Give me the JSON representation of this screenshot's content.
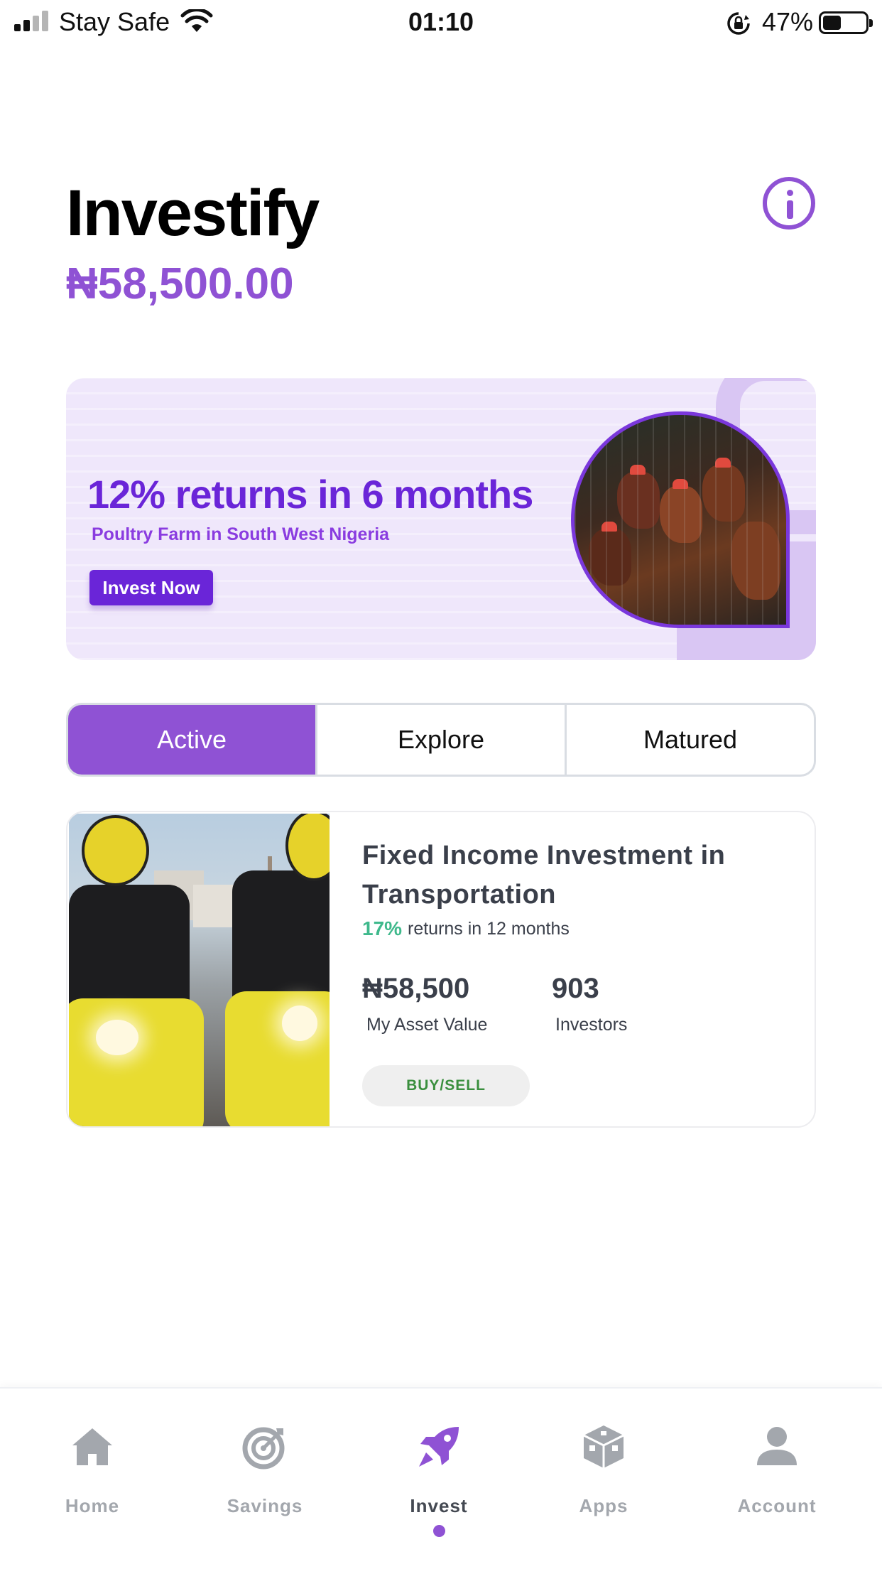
{
  "status_bar": {
    "carrier": "Stay Safe",
    "time": "01:10",
    "battery_percent": "47%",
    "battery_level": 0.47,
    "signal_bars": 2
  },
  "header": {
    "title": "Investify",
    "balance": "₦58,500.00",
    "info_icon": "info-circle-icon"
  },
  "banner": {
    "headline": "12% returns in 6 months",
    "subtitle": "Poultry Farm in South West Nigeria",
    "cta_label": "Invest Now"
  },
  "tabs": [
    {
      "label": "Active",
      "selected": true
    },
    {
      "label": "Explore",
      "selected": false
    },
    {
      "label": "Matured",
      "selected": false
    }
  ],
  "investment": {
    "title": "Fixed Income Investment in Transportation",
    "rate": "17%",
    "rate_text": "returns in 12 months",
    "asset_value": "₦58,500",
    "asset_value_label": "My Asset Value",
    "investors": "903",
    "investors_label": "Investors",
    "action_label": "BUY/SELL"
  },
  "bottom_nav": [
    {
      "label": "Home",
      "icon": "home-icon",
      "active": false
    },
    {
      "label": "Savings",
      "icon": "target-icon",
      "active": false
    },
    {
      "label": "Invest",
      "icon": "rocket-icon",
      "active": true
    },
    {
      "label": "Apps",
      "icon": "cube-icon",
      "active": false
    },
    {
      "label": "Account",
      "icon": "user-icon",
      "active": false
    }
  ],
  "colors": {
    "accent": "#8f52d4",
    "banner_purple": "#6a25d8",
    "rate_green": "#3fb98c",
    "buy_green": "#3a8f3e",
    "nav_inactive": "#a3a7ad"
  }
}
